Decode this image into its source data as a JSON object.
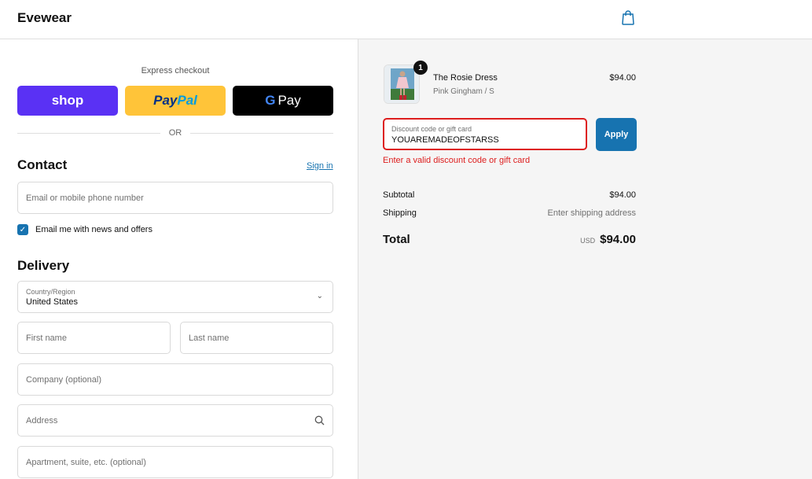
{
  "header": {
    "brand": "Evewear",
    "cart_icon": "shopping-bag-icon"
  },
  "express": {
    "label": "Express checkout",
    "shop_label": "shop",
    "paypal_part1": "Pay",
    "paypal_part2": "Pal",
    "gpay_g": "G",
    "gpay_label": "Pay",
    "or_label": "OR"
  },
  "contact": {
    "title": "Contact",
    "sign_in": "Sign in",
    "email_placeholder": "Email or mobile phone number",
    "newsletter_label": "Email me with news and offers",
    "newsletter_checked": true
  },
  "delivery": {
    "title": "Delivery",
    "country_label": "Country/Region",
    "country_value": "United States",
    "first_name": "First name",
    "last_name": "Last name",
    "company": "Company (optional)",
    "address": "Address",
    "apartment": "Apartment, suite, etc. (optional)"
  },
  "cart": {
    "item": {
      "name": "The Rosie Dress",
      "variant": "Pink Gingham / S",
      "price": "$94.00",
      "quantity": "1"
    },
    "discount_label": "Discount code or gift card",
    "discount_value": "YOUAREMADEOFSTARSS",
    "apply_label": "Apply",
    "error": "Enter a valid discount code or gift card",
    "subtotal_label": "Subtotal",
    "subtotal_value": "$94.00",
    "shipping_label": "Shipping",
    "shipping_value": "Enter shipping address",
    "total_label": "Total",
    "total_currency": "USD",
    "total_value": "$94.00"
  },
  "colors": {
    "accent": "#1773b0",
    "error": "#dd1d1d",
    "shop": "#5a31f4",
    "paypal": "#ffc439"
  }
}
